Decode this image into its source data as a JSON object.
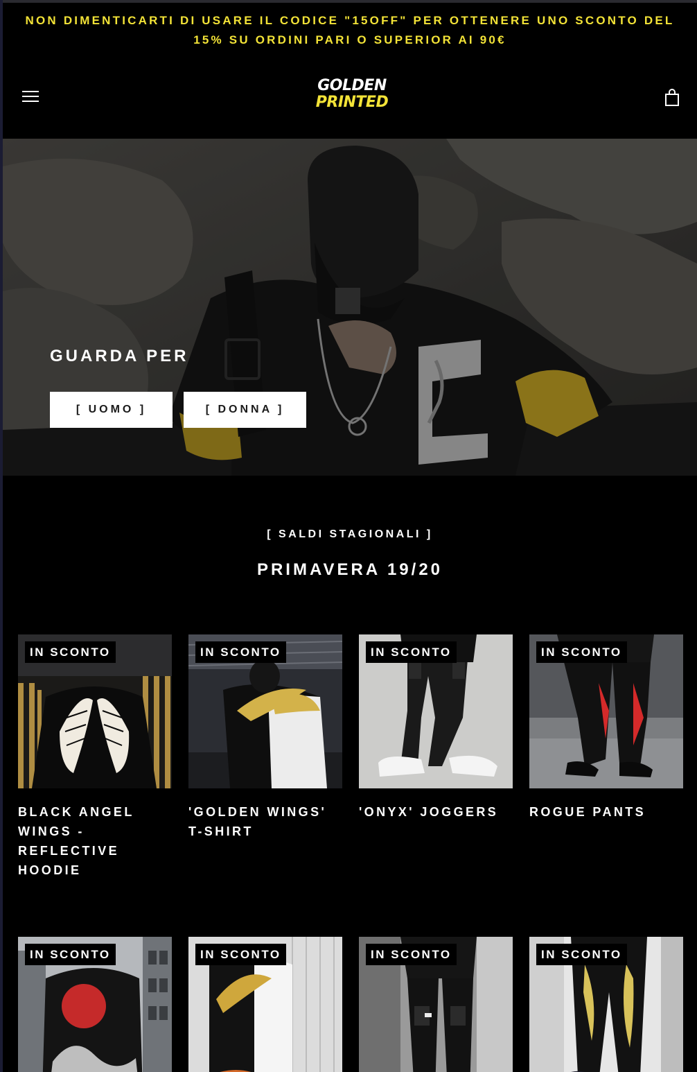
{
  "announcement": {
    "text": "NON DIMENTICARTI DI USARE IL CODICE \"15OFF\" PER OTTENERE UNO SCONTO DEL 15% SU ORDINI PARI O SUPERIOR AI 90€"
  },
  "header": {
    "logo_line1": "GOLDEN",
    "logo_line2": "PRINTED",
    "menu_icon": "hamburger-menu-icon",
    "cart_icon": "shopping-bag-icon"
  },
  "hero": {
    "title": "GUARDA PER",
    "buttons": [
      "[ UOMO ]",
      "[ DONNA ]"
    ]
  },
  "section": {
    "eyebrow": "[ SALDI STAGIONALI ]",
    "title": "PRIMAVERA 19/20"
  },
  "products": [
    {
      "name": "BLACK ANGEL WINGS - REFLECTIVE HOODIE",
      "badge": "IN SCONTO"
    },
    {
      "name": "'GOLDEN WINGS' T-SHIRT",
      "badge": "IN SCONTO"
    },
    {
      "name": "'ONYX' JOGGERS",
      "badge": "IN SCONTO"
    },
    {
      "name": "ROGUE PANTS",
      "badge": "IN SCONTO"
    },
    {
      "name": "",
      "badge": "IN SCONTO"
    },
    {
      "name": "",
      "badge": "IN SCONTO"
    },
    {
      "name": "",
      "badge": "IN SCONTO"
    },
    {
      "name": "",
      "badge": "IN SCONTO"
    }
  ],
  "colors": {
    "accent_yellow": "#f3e337",
    "background": "#000000",
    "text": "#ffffff"
  }
}
